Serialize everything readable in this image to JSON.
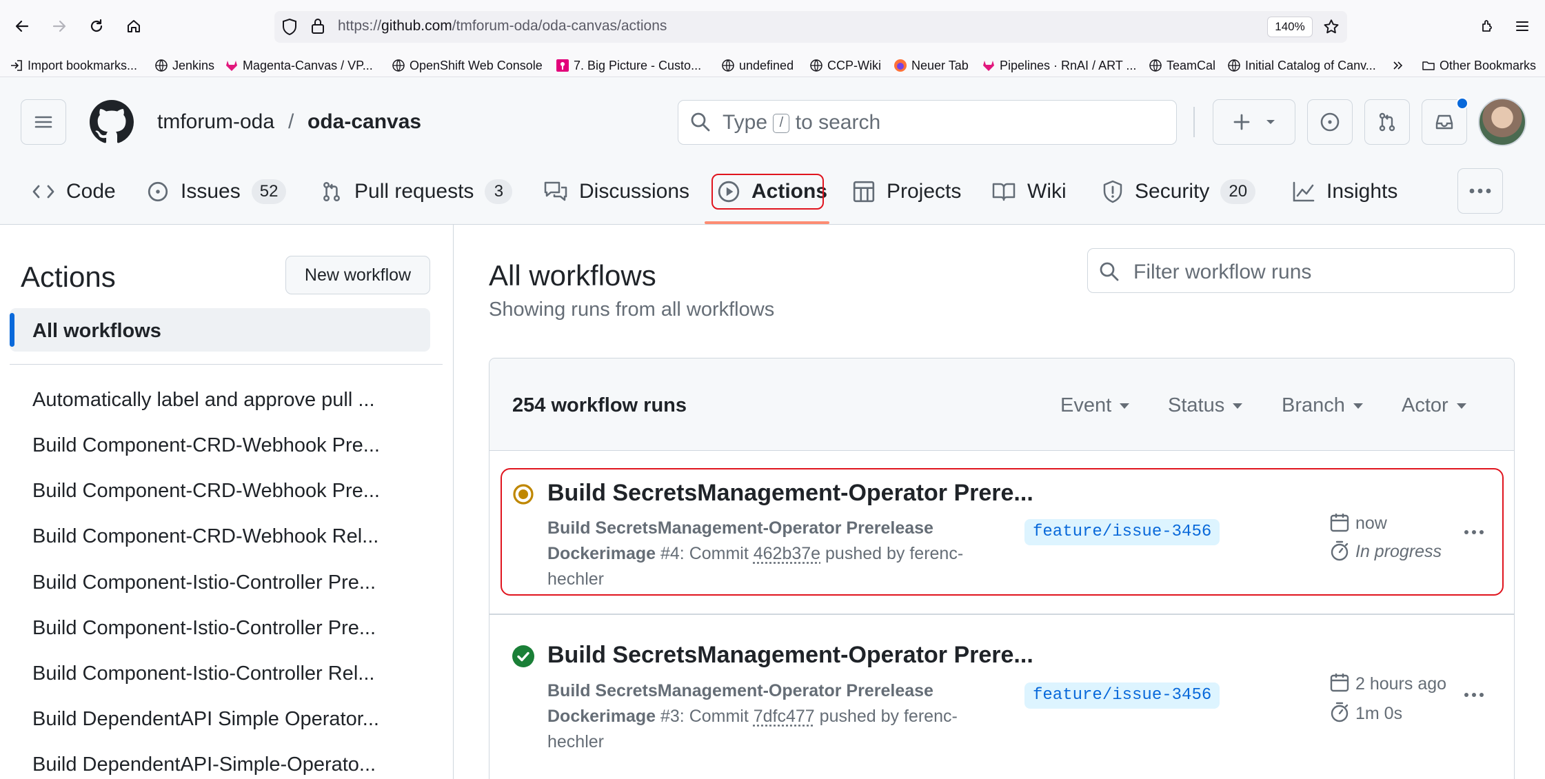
{
  "browser": {
    "url_prefix": "https://",
    "url_host": "github.com",
    "url_path": "/tmforum-oda/oda-canvas/actions",
    "zoom": "140%",
    "bookmarks": [
      {
        "label": "Import bookmarks...",
        "icon": "import-icon"
      },
      {
        "label": "Jenkins",
        "icon": "globe-icon"
      },
      {
        "label": "Magenta-Canvas / VP...",
        "icon": "gitlab-icon"
      },
      {
        "label": "OpenShift Web Console",
        "icon": "globe-icon"
      },
      {
        "label": "7. Big Picture - Custo...",
        "icon": "magenta-icon"
      },
      {
        "label": "undefined",
        "icon": "globe-icon"
      },
      {
        "label": "CCP-Wiki",
        "icon": "globe-icon"
      },
      {
        "label": "Neuer Tab",
        "icon": "firefox-icon"
      },
      {
        "label": "Pipelines · RnAI / ART ...",
        "icon": "gitlab-icon"
      },
      {
        "label": "TeamCal",
        "icon": "globe-icon"
      },
      {
        "label": "Initial Catalog of Canv...",
        "icon": "globe-icon"
      }
    ],
    "other_bookmarks": "Other Bookmarks"
  },
  "header": {
    "owner": "tmforum-oda",
    "separator": "/",
    "repo": "oda-canvas",
    "search_prefix": "Type",
    "search_key": "/",
    "search_suffix": "to search"
  },
  "tabs": [
    {
      "label": "Code",
      "icon": "code-icon"
    },
    {
      "label": "Issues",
      "icon": "issue-icon",
      "count": "52"
    },
    {
      "label": "Pull requests",
      "icon": "pull-request-icon",
      "count": "3"
    },
    {
      "label": "Discussions",
      "icon": "discussions-icon"
    },
    {
      "label": "Actions",
      "icon": "play-icon",
      "selected": true
    },
    {
      "label": "Projects",
      "icon": "table-icon"
    },
    {
      "label": "Wiki",
      "icon": "book-icon"
    },
    {
      "label": "Security",
      "icon": "shield-icon",
      "count": "20"
    },
    {
      "label": "Insights",
      "icon": "graph-icon"
    }
  ],
  "sidebar": {
    "title": "Actions",
    "new_workflow": "New workflow",
    "all_workflows": "All workflows",
    "workflows": [
      "Automatically label and approve pull ...",
      "Build Component-CRD-Webhook Pre...",
      "Build Component-CRD-Webhook Pre...",
      "Build Component-CRD-Webhook Rel...",
      "Build Component-Istio-Controller Pre...",
      "Build Component-Istio-Controller Pre...",
      "Build Component-Istio-Controller Rel...",
      "Build DependentAPI Simple Operator...",
      "Build DependentAPI-Simple-Operato..."
    ]
  },
  "main": {
    "title": "All workflows",
    "subtitle": "Showing runs from all workflows",
    "filter_placeholder": "Filter workflow runs",
    "runs_count": "254 workflow runs",
    "filters": [
      "Event",
      "Status",
      "Branch",
      "Actor"
    ],
    "runs": [
      {
        "title": "Build SecretsManagement-Operator Prere...",
        "workflow_line1": "Build SecretsManagement-Operator Prerelease",
        "workflow_line2": "Dockerimage",
        "run_number": "#4",
        "commit_label": ": Commit",
        "sha": "462b37e",
        "pushed_by": "pushed by ferenc-",
        "author_tail": "hechler",
        "branch": "feature/issue-3456",
        "time": "now",
        "duration": "In progress",
        "status": "in-progress",
        "status_color": "#bf8700"
      },
      {
        "title": "Build SecretsManagement-Operator Prere...",
        "workflow_line1": "Build SecretsManagement-Operator Prerelease",
        "workflow_line2": "Dockerimage",
        "run_number": "#3",
        "commit_label": ": Commit",
        "sha": "7dfc477",
        "pushed_by": "pushed by ferenc-",
        "author_tail": "hechler",
        "branch": "feature/issue-3456",
        "time": "2 hours ago",
        "duration": "1m 0s",
        "status": "success",
        "status_color": "#1a7f37"
      }
    ]
  },
  "colors": {
    "accent": "#0969da",
    "highlight": "#e0141e",
    "tab_underline": "#fd8c73"
  }
}
